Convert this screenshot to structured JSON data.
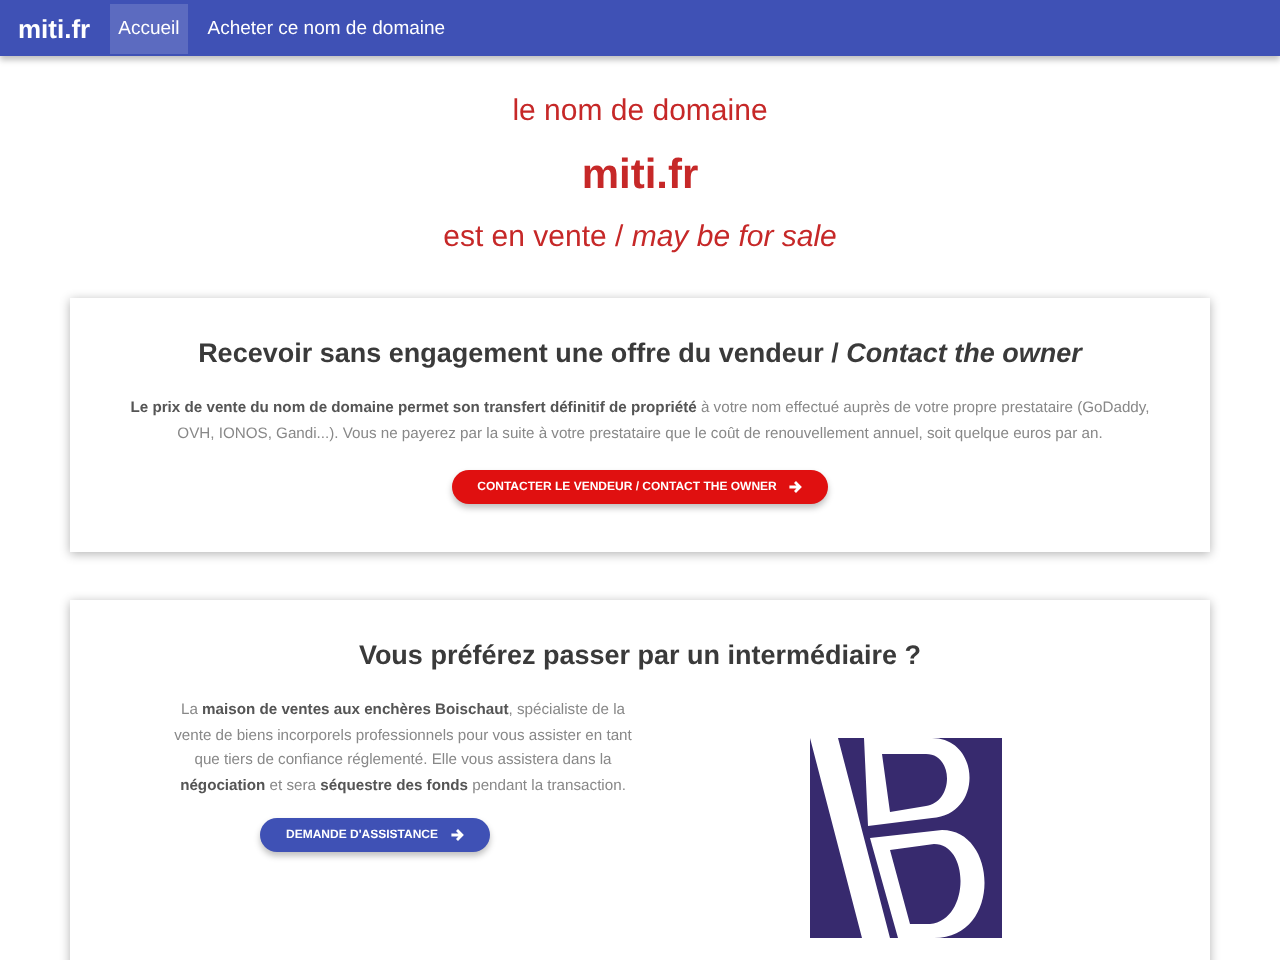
{
  "navbar": {
    "brand": "miti.fr",
    "links": [
      {
        "label": "Accueil",
        "selected": true
      },
      {
        "label": "Acheter ce nom de domaine",
        "selected": false
      }
    ]
  },
  "hero": {
    "line_1": "le nom de domaine",
    "domain": "miti.fr",
    "line_2": "est en vente / *may be for sale*"
  },
  "cards": [
    {
      "kind": "contact",
      "title": "Recevoir sans engagement une offre du vendeur / *Contact the owner*",
      "text": "**Le prix de vente du nom de domaine permet son transfert définitif de propriété** à votre nom effectué auprès de votre propre prestataire (GoDaddy, OVH, IONOS, Gandi...). Vous ne payerez par la suite à votre prestataire que le coût de renouvellement annuel, soit quelque euros par an.",
      "button": "CONTACTER LE VENDEUR / CONTACT THE OWNER"
    },
    {
      "kind": "broker",
      "title": "Vous préférez passer par un intermédiaire ?",
      "text": "La **maison de ventes aux enchères Boischaut**, spécialiste de la vente de biens incorporels professionnels pour vous assister en tant que tiers de confiance réglementé. Elle vous assistera dans la **négociation** et sera **séquestre des fonds** pendant la transaction.",
      "button": "DEMANDE D'ASSISTANCE"
    }
  ]
}
